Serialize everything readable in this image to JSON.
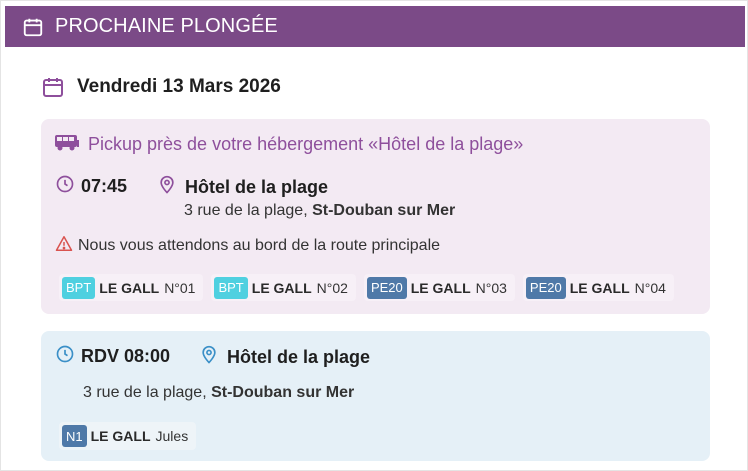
{
  "header": {
    "title": "PROCHAINE PLONGÉE",
    "icon": "calendar-icon"
  },
  "date": {
    "label": "Vendredi 13 Mars 2026",
    "icon": "calendar-icon"
  },
  "pickup": {
    "title": "Pickup près de votre hébergement «Hôtel de la plage»",
    "icon": "bus-icon",
    "time": "07:45",
    "time_icon": "clock-icon",
    "location": "Hôtel de la plage",
    "location_icon": "location-pin-icon",
    "address_prefix": "3 rue de la plage, ",
    "address_city": "St-Douban sur Mer",
    "warning": "Nous vous attendons au bord de la route principale",
    "warning_icon": "warning-icon",
    "chips": [
      {
        "badge": "BPT",
        "name": "LE GALL",
        "number": "N°01",
        "badge_color": "#4fd0e0"
      },
      {
        "badge": "BPT",
        "name": "LE GALL",
        "number": "N°02",
        "badge_color": "#4fd0e0"
      },
      {
        "badge": "PE20",
        "name": "LE GALL",
        "number": "N°03",
        "badge_color": "#4f79a8"
      },
      {
        "badge": "PE20",
        "name": "LE GALL",
        "number": "N°04",
        "badge_color": "#4f79a8"
      }
    ]
  },
  "rdv": {
    "time": "RDV 08:00",
    "time_icon": "clock-icon",
    "location": "Hôtel de la plage",
    "location_icon": "location-pin-icon",
    "address_prefix": "3 rue de la plage, ",
    "address_city": "St-Douban sur Mer",
    "chip": {
      "badge": "N1",
      "name": "LE GALL",
      "first_name": "Jules",
      "badge_color": "#4f79a8"
    }
  },
  "colors": {
    "header_bg": "#7b4a87",
    "pickup_bg": "#f3eaf3",
    "pickup_accent": "#8e4f9c",
    "rdv_bg": "#e5f0f7",
    "rdv_accent": "#3a8fc7",
    "warning": "#d9534f"
  }
}
